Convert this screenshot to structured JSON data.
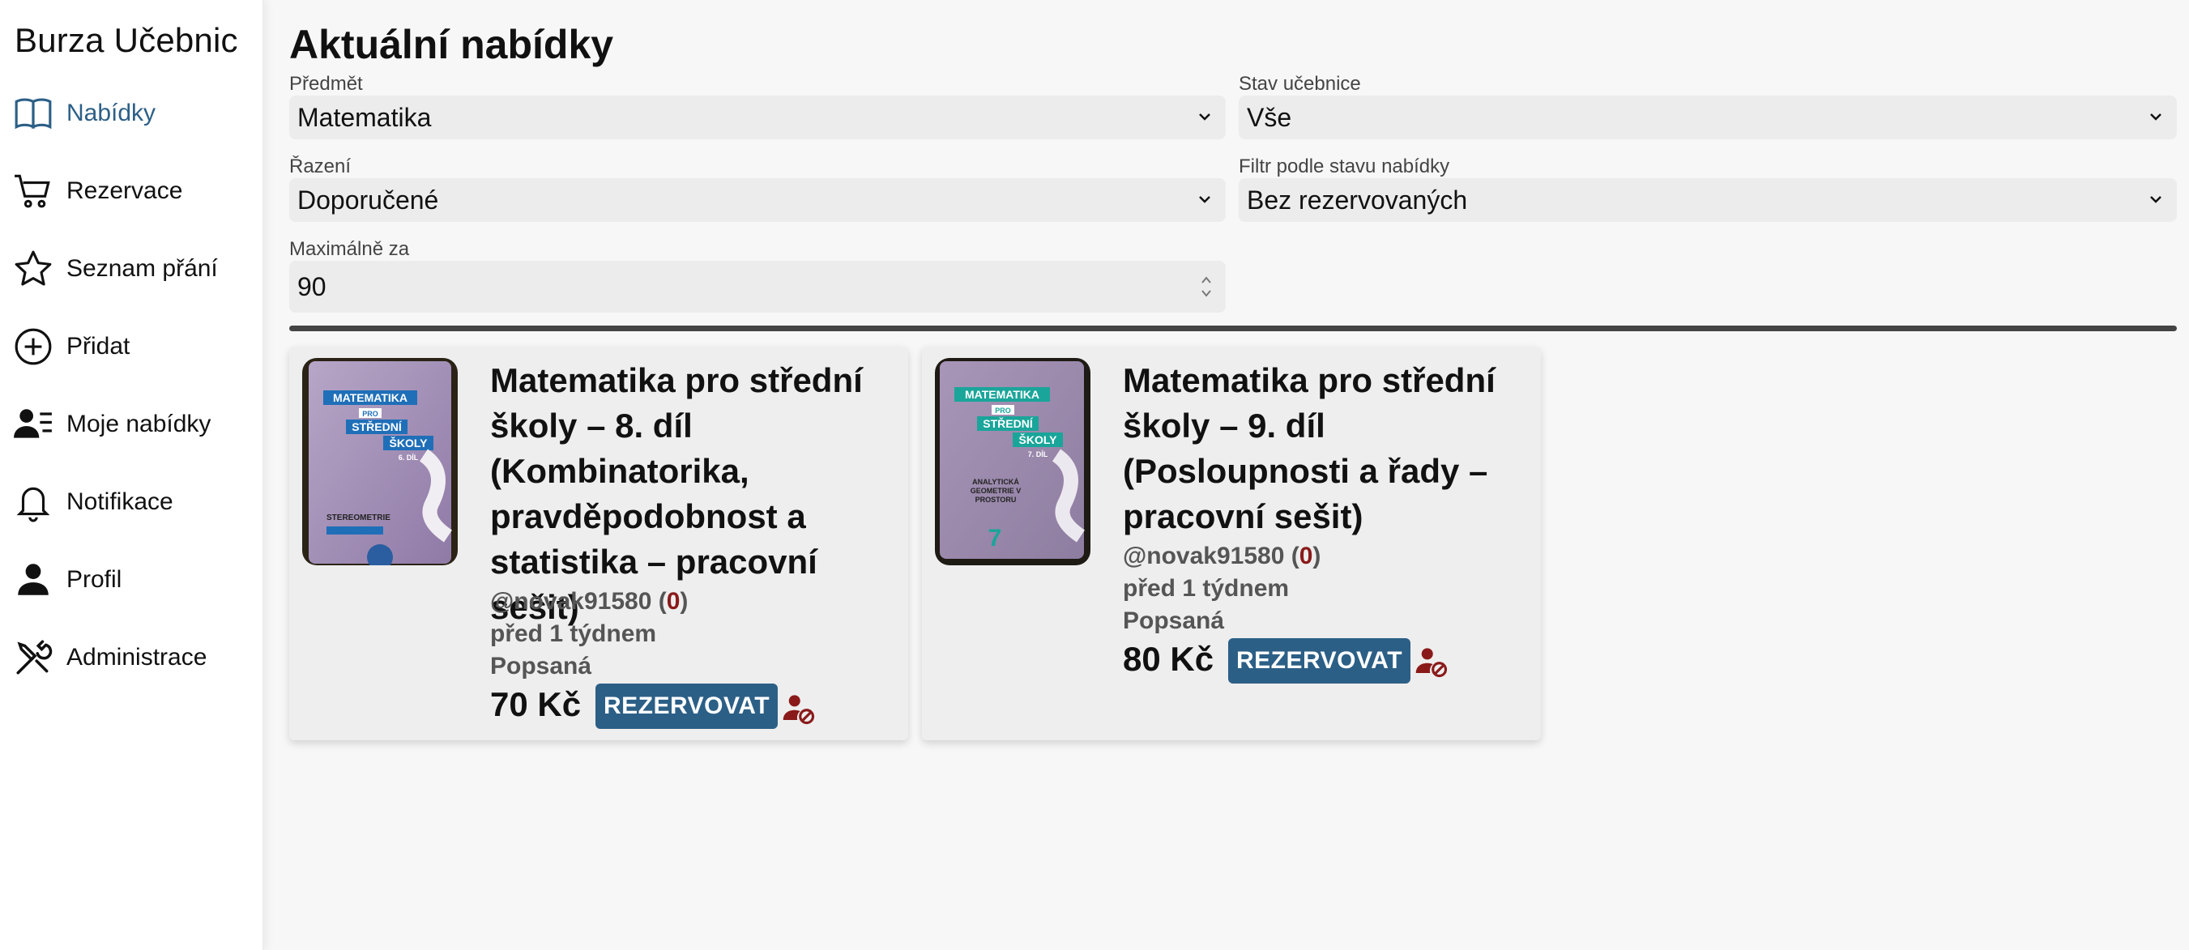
{
  "app": {
    "brand": "Burza Učebnic"
  },
  "sidebar": {
    "items": [
      {
        "label": "Nabídky",
        "icon": "book-icon",
        "active": true
      },
      {
        "label": "Rezervace",
        "icon": "cart-icon"
      },
      {
        "label": "Seznam přání",
        "icon": "star-icon"
      },
      {
        "label": "Přidat",
        "icon": "plus-circle-icon"
      },
      {
        "label": "Moje nabídky",
        "icon": "user-list-icon"
      },
      {
        "label": "Notifikace",
        "icon": "bell-icon"
      },
      {
        "label": "Profil",
        "icon": "person-icon"
      },
      {
        "label": "Administrace",
        "icon": "tools-icon"
      }
    ]
  },
  "main": {
    "title": "Aktuální nabídky",
    "filters": {
      "subject": {
        "label": "Předmět",
        "value": "Matematika"
      },
      "condition": {
        "label": "Stav učebnice",
        "value": "Vše"
      },
      "sort": {
        "label": "Řazení",
        "value": "Doporučené"
      },
      "offer_state": {
        "label": "Filtr podle stavu nabídky",
        "value": "Bez rezervovaných"
      },
      "max_price": {
        "label": "Maximálně za",
        "value": "90"
      }
    },
    "offers": [
      {
        "title": "Matematika pro střední školy – 8. díl (Kombinatorika, pravděpodobnost a statistika – pracovní sešit)",
        "seller": "@novak91580",
        "seller_rating_open": " (",
        "seller_rating": "0",
        "seller_rating_close": ")",
        "posted": "před 1 týdnem",
        "condition": "Popsaná",
        "price": "70 Kč",
        "reserve_label": "REZERVOVAT",
        "cover": {
          "series": "MATEMATIKA",
          "pro": "PRO",
          "line1": "STŘEDNÍ",
          "line2": "ŠKOLY",
          "part": "6. DÍL",
          "subtitle": "STEREOMETRIE"
        }
      },
      {
        "title": "Matematika pro střední školy – 9. díl (Posloupnosti a řady – pracovní sešit)",
        "seller": "@novak91580",
        "seller_rating_open": " (",
        "seller_rating": "0",
        "seller_rating_close": ")",
        "posted": "před 1 týdnem",
        "condition": "Popsaná",
        "price": "80 Kč",
        "reserve_label": "REZERVOVAT",
        "cover": {
          "series": "MATEMATIKA",
          "pro": "PRO",
          "line1": "STŘEDNÍ",
          "line2": "ŠKOLY",
          "part": "7. DÍL",
          "subtitle": "ANALYTICKÁ GEOMETRIE V PROSTORU",
          "big_number": "7"
        }
      }
    ]
  },
  "colors": {
    "accent": "#2c5f86",
    "danger": "#8a1a1a"
  }
}
